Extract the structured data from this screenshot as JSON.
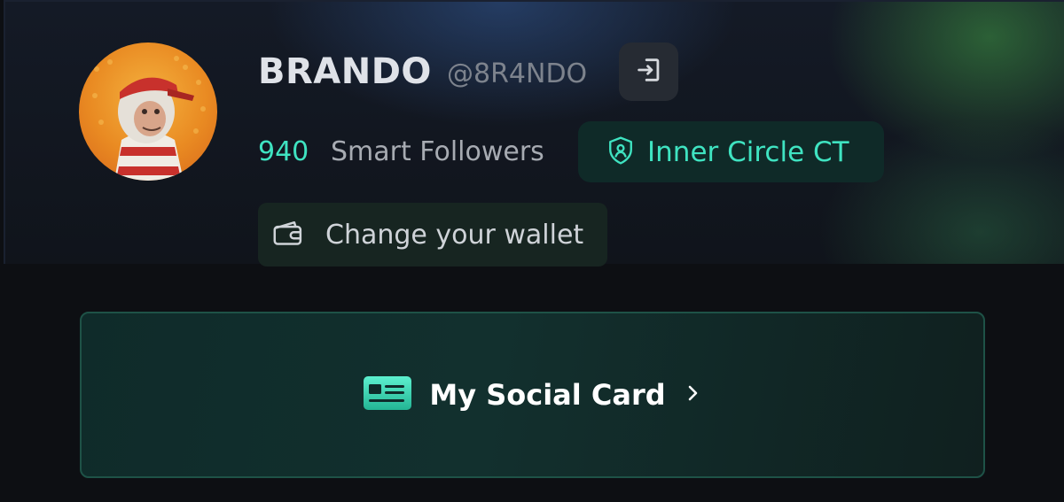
{
  "profile": {
    "name": "BRANDO",
    "handle": "@8R4NDO",
    "avatar_icon": "ape-avatar"
  },
  "stats": {
    "smart_followers_count": "940",
    "smart_followers_label": "Smart Followers"
  },
  "badge": {
    "label": "Inner Circle CT",
    "icon": "shield-user-icon"
  },
  "actions": {
    "logout_icon": "logout-icon",
    "wallet_label": "Change your wallet",
    "wallet_icon": "wallet-icon"
  },
  "social_card": {
    "label": "My Social Card",
    "icon": "id-card-icon",
    "chevron_icon": "chevron-right-icon"
  },
  "colors": {
    "accent": "#3fe3c1",
    "background": "#0d0f13",
    "card_border": "#1e5247"
  }
}
